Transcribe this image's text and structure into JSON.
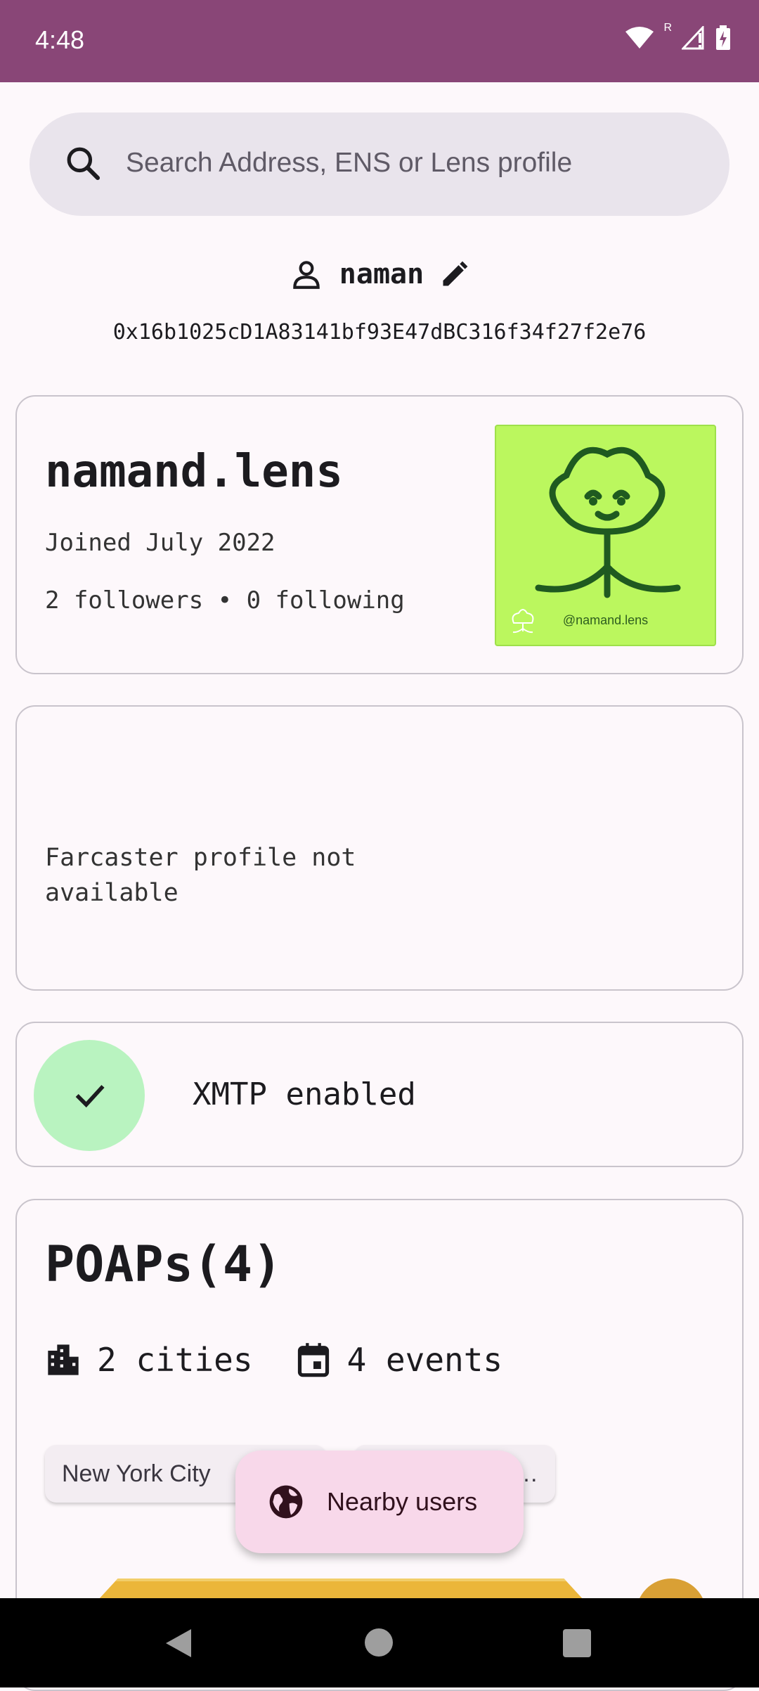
{
  "status_bar": {
    "time": "4:48",
    "roaming": "R"
  },
  "search": {
    "placeholder": "Search Address, ENS or Lens profile",
    "icon": "search-icon"
  },
  "user": {
    "name": "naman",
    "address": "0x16b1025cD1A83141bf93E47dBC316f34f27f2e76"
  },
  "lens": {
    "handle": "namand.lens",
    "joined": "Joined July 2022",
    "follow_summary": "2 followers • 0 following",
    "avatar_caption": "@namand.lens",
    "avatar_bg": "#BBF75E"
  },
  "farcaster": {
    "message": "Farcaster profile not available"
  },
  "xmtp": {
    "label": "XMTP enabled",
    "badge_color": "#B9F3C0"
  },
  "poaps": {
    "title": "POAPs(4)",
    "cities": "2 cities",
    "events": "4 events",
    "chips": [
      "New York City",
      "…"
    ]
  },
  "fab": {
    "label": "Nearby users",
    "icon": "globe-icon"
  },
  "colors": {
    "status_bar": "#894677",
    "fab_bg": "#F8D8EA",
    "background": "#FDF8FB"
  }
}
